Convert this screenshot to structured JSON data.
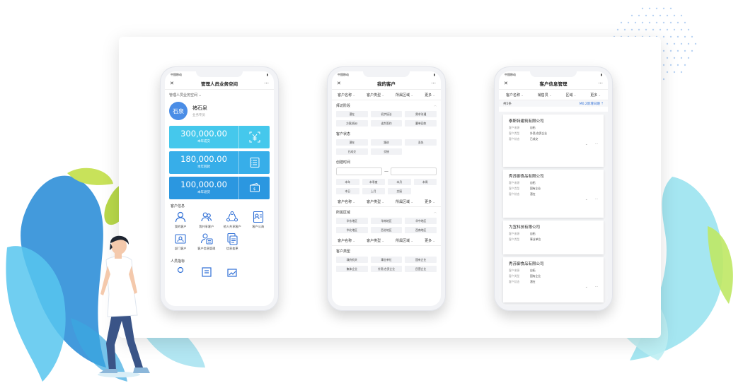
{
  "colors": {
    "accent": "#36a8e6",
    "stat1": "#45c8ec",
    "stat2": "#37aee9",
    "stat3": "#2b97e0",
    "avatar": "#4a8de6"
  },
  "phone1": {
    "status": {
      "carrier": "中国移动",
      "time": "",
      "battery": ""
    },
    "nav": {
      "close": "✕",
      "title": "管理人员业务空间",
      "more": "···"
    },
    "space_selector": "管理人员业务空间 ⌄",
    "profile": {
      "avatar_text": "石泉",
      "name": "褚石泉",
      "role": "业务专员"
    },
    "stats": [
      {
        "value": "300,000.00",
        "label": "本年成交",
        "icon": "yen-scan-icon"
      },
      {
        "value": "180,000.00",
        "label": "本年回款",
        "icon": "document-list-icon"
      },
      {
        "value": "100,000.00",
        "label": "本年退货",
        "icon": "wallet-icon"
      }
    ],
    "section1": "客户信息",
    "grid": [
      {
        "label": "我的客户",
        "icon": "person-icon"
      },
      {
        "label": "我共享客户",
        "icon": "group-icon"
      },
      {
        "label": "他人共享客户",
        "icon": "share-cycle-icon"
      },
      {
        "label": "客户公海",
        "icon": "id-card-icon"
      },
      {
        "label": "部门客户",
        "icon": "department-icon"
      },
      {
        "label": "客户信息管理",
        "icon": "person-card-icon"
      },
      {
        "label": "信息变更",
        "icon": "docs-change-icon"
      }
    ],
    "section2": "人员指标"
  },
  "phone2": {
    "status": {
      "carrier": "中国移动"
    },
    "nav": {
      "close": "✕",
      "title": "我的客户",
      "more": "···"
    },
    "filter": [
      "客户名称",
      "客户类型",
      "所属区域",
      "更多"
    ],
    "stage_title": "拜访阶段",
    "stage_chips": [
      "潜在",
      "初步接洽",
      "需求沟通",
      "方案/报价",
      "谈判签约",
      "赢单回款"
    ],
    "state_title": "客户状态",
    "state_chips": [
      "潜在",
      "跟进",
      "丢失",
      "已成交",
      "交接"
    ],
    "time_title": "创建时间",
    "date_dash": "—",
    "time_chips": [
      "本年",
      "本季度",
      "本月",
      "本周",
      "本日",
      "上月",
      "交接"
    ],
    "region_title": "所属区域",
    "region_chips": [
      "华东地区",
      "华南地区",
      "华中地区",
      "华北地区",
      "西北地区",
      "西南地区"
    ],
    "type_title": "客户类型",
    "type_chips": [
      "政府机关",
      "事业单位",
      "国有企业",
      "集体企业",
      "外资/合资企业",
      "民营企业"
    ]
  },
  "phone3": {
    "status": {
      "carrier": "中国移动"
    },
    "nav": {
      "close": "✕",
      "title": "客户信息管理",
      "more": "···"
    },
    "filter": [
      "客户名称",
      "销售员",
      "区域",
      "更多"
    ],
    "count_label": "共5条",
    "sort_label": "M0.2新增日期 ⇡",
    "keys": {
      "source": "客户来源",
      "type": "客户类型",
      "state": "客户状态"
    },
    "cards": [
      {
        "name": "泰斯特建筑有限公司",
        "source": "自拓",
        "type": "外资/合资企业",
        "state": "已成交"
      },
      {
        "name": "秀苏御食品有限公司",
        "source": "自拓",
        "type": "国有企业",
        "state": "潜在"
      },
      {
        "name": "为宜科技有限公司",
        "source": "自拓",
        "type": "事业单位",
        "state": ""
      },
      {
        "name": "秀苏御食品有限公司",
        "source": "自拓",
        "type": "国有企业",
        "state": "潜在"
      }
    ],
    "expand": "⌄",
    "more": "···"
  }
}
